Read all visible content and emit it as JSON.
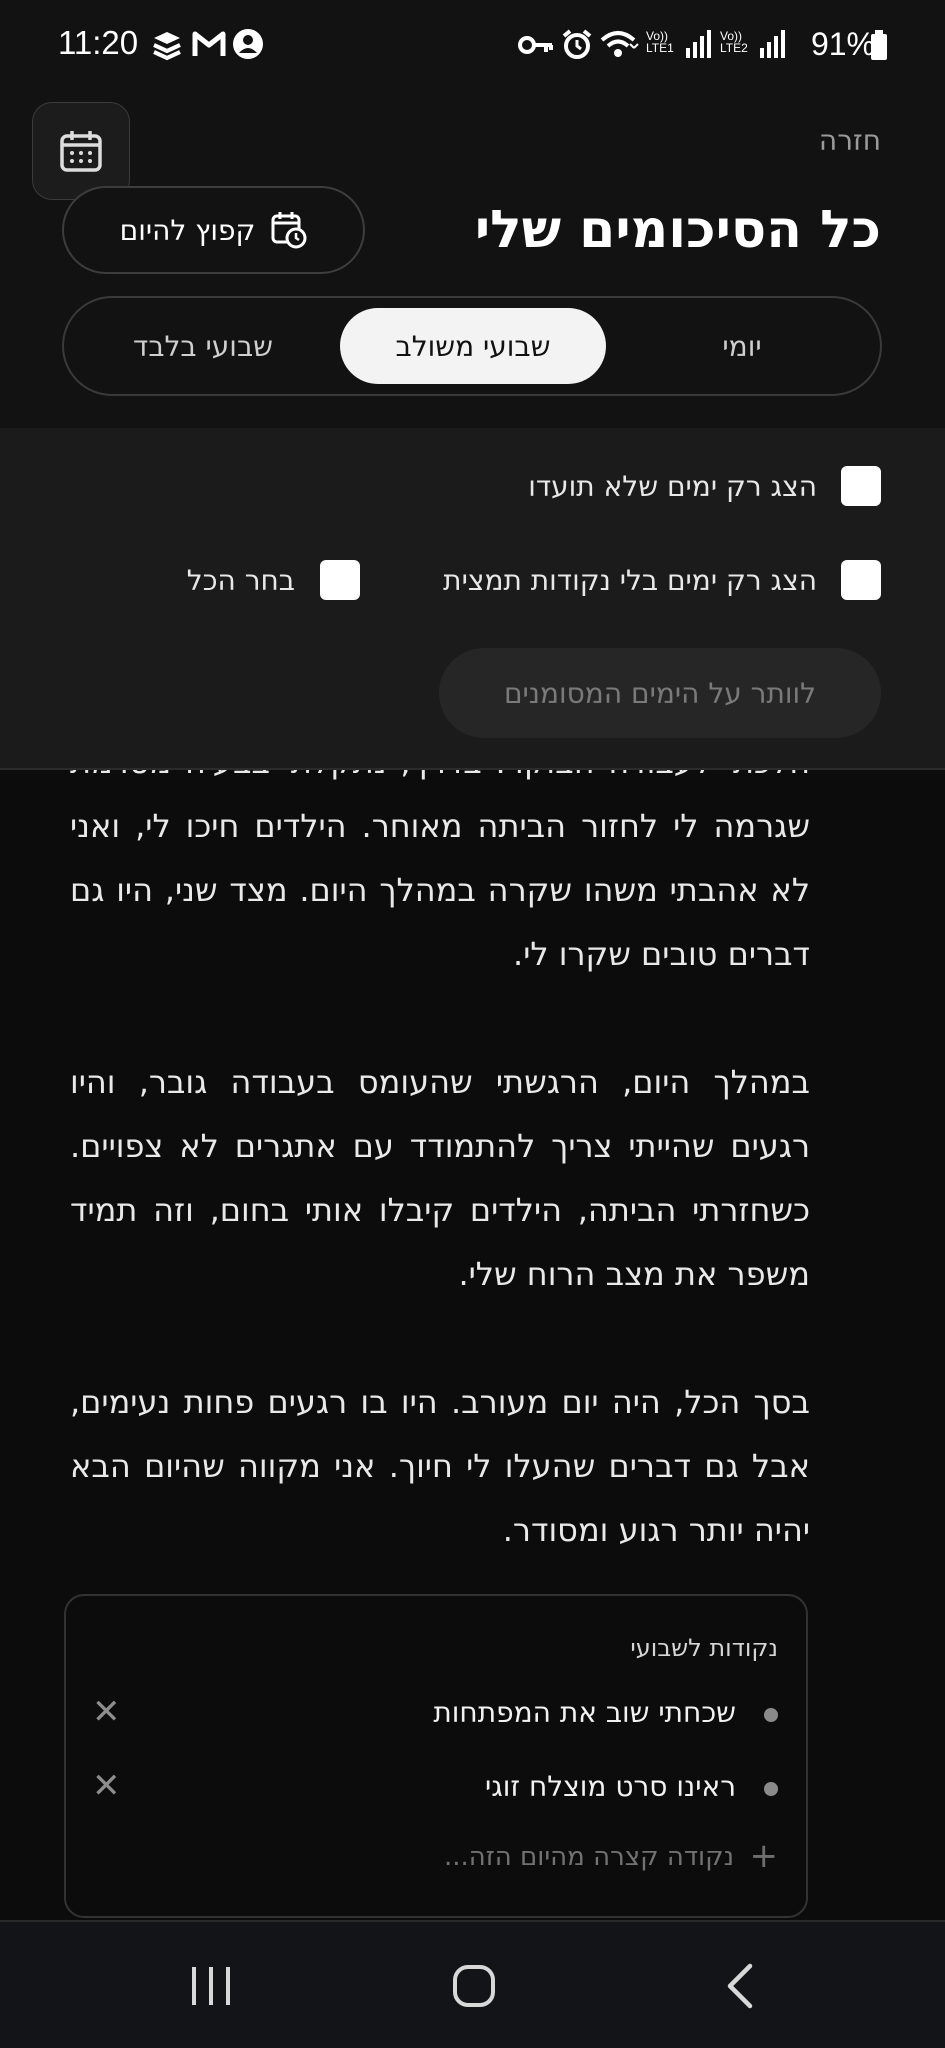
{
  "status_bar": {
    "time": "11:20",
    "battery": "91%",
    "sim1": "LTE1",
    "sim2": "LTE2",
    "volte": "Vo))",
    "icons": [
      "app-icon",
      "gmail-icon",
      "account-icon",
      "key-icon",
      "alarm-icon",
      "wifi-icon",
      "signal-icon",
      "battery-icon"
    ]
  },
  "header": {
    "back": "חזרה",
    "title": "כל הסיכומים שלי",
    "jump_today": "קפוץ להיום"
  },
  "tabs": [
    {
      "label": "יומי",
      "active": false
    },
    {
      "label": "שבועי משולב",
      "active": true
    },
    {
      "label": "שבועי בלבד",
      "active": false
    }
  ],
  "filters": {
    "only_undocumented": "הצג רק ימים שלא תועדו",
    "only_no_points": "הצג רק ימים בלי נקודות תמצית",
    "select_all": "בחר הכל",
    "skip_selected": "לוותר על הימים המסומנים"
  },
  "content": {
    "paragraph_1": "הלכתי לעבודה הבוקר. בדרך, נתקלתי בבעיה מסוימת שגרמה לי לחזור הביתה מאוחר. הילדים חיכו לי, ואני לא אהבתי משהו שקרה במהלך היום. מצד שני, היו גם דברים טובים שקרו לי.",
    "paragraph_2": "במהלך היום, הרגשתי שהעומס בעבודה גובר, והיו רגעים שהייתי צריך להתמודד עם אתגרים לא צפויים. כשחזרתי הביתה, הילדים קיבלו אותי בחום, וזה תמיד משפר את מצב הרוח שלי.",
    "paragraph_3": "בסך הכל, היה יום מעורב. היו בו רגעים פחות נעימים, אבל גם דברים שהעלו לי חיוך. אני מקווה שהיום הבא יהיה יותר רגוע ומסודר."
  },
  "points_card": {
    "title": "נקודות לשבועי",
    "items": [
      "שכחתי שוב את המפתחות",
      "ראינו סרט מוצלח זוגי"
    ],
    "add_placeholder": "נקודה קצרה מהיום הזה..."
  },
  "colors": {
    "background": "#0c0c0c",
    "panel": "#1b1b1b",
    "active_tab": "#f3f3f3"
  }
}
